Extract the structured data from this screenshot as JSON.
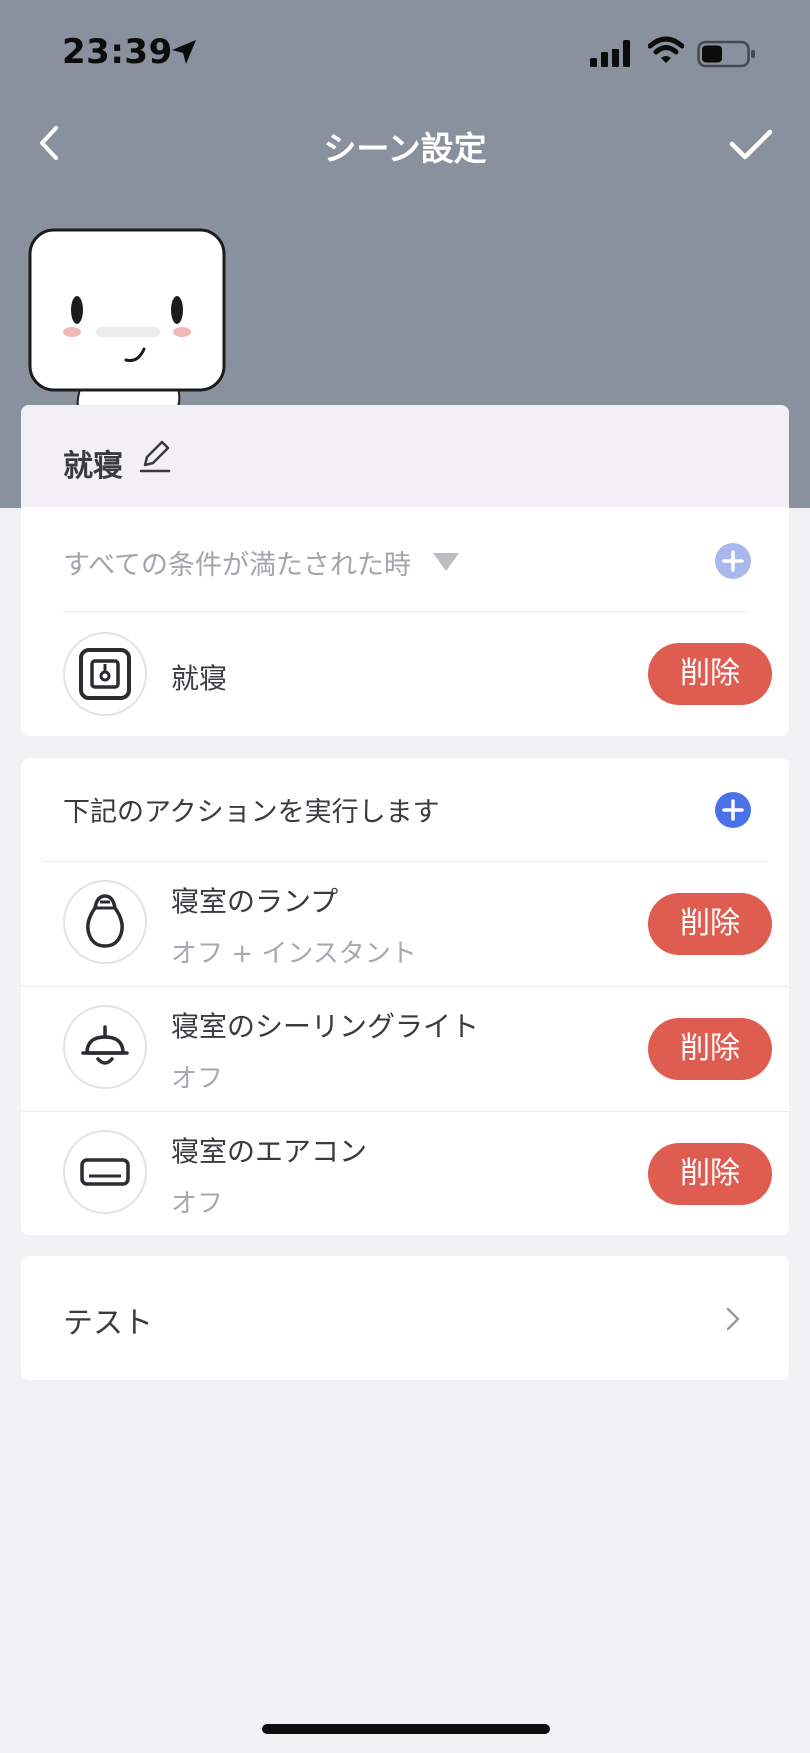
{
  "status_bar": {
    "time": "23:39"
  },
  "nav": {
    "title": "シーン設定",
    "back_icon": "chevron-left-icon",
    "confirm_icon": "checkmark-icon"
  },
  "scene": {
    "name": "就寝"
  },
  "conditions": {
    "header": "すべての条件が満たされた時",
    "items": [
      {
        "title": "就寝",
        "icon": "scene-tag-icon",
        "delete_label": "削除"
      }
    ]
  },
  "actions": {
    "header": "下記のアクションを実行します",
    "items": [
      {
        "title": "寝室のランプ",
        "subtitle": "オフ + インスタント",
        "icon": "bulb-icon",
        "delete_label": "削除"
      },
      {
        "title": "寝室のシーリングライト",
        "subtitle": "オフ",
        "icon": "ceiling-light-icon",
        "delete_label": "削除"
      },
      {
        "title": "寝室のエアコン",
        "subtitle": "オフ",
        "icon": "air-conditioner-icon",
        "delete_label": "削除"
      }
    ]
  },
  "test": {
    "label": "テスト"
  },
  "colors": {
    "header_bg": "#8a919e",
    "accent_blue": "#4a72e8",
    "accent_blue_light": "#a9b9ee",
    "delete_red": "#df5c51"
  }
}
